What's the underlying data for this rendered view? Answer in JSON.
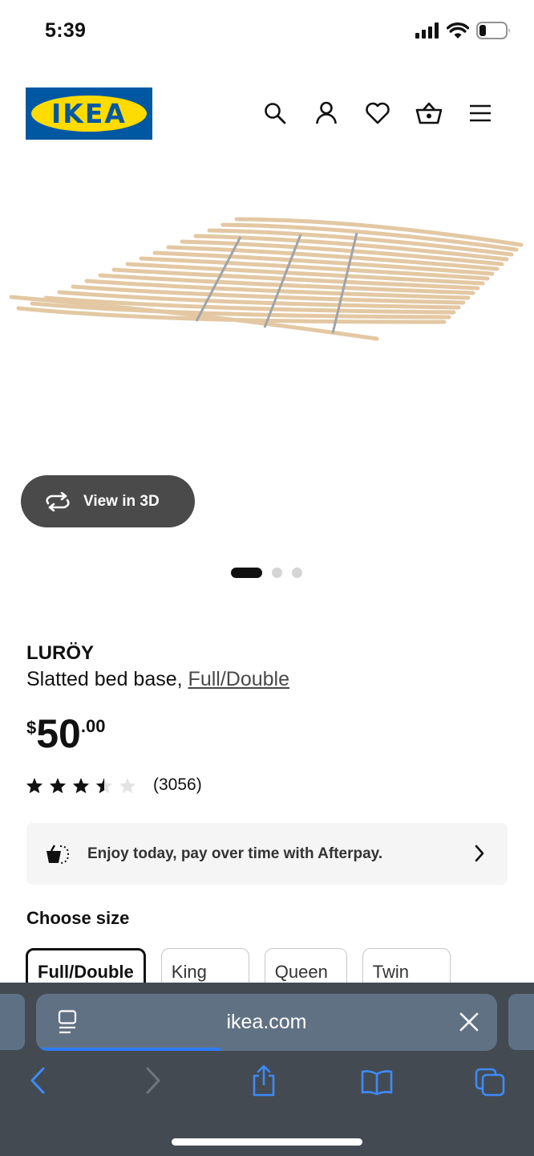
{
  "status_bar": {
    "time": "5:39"
  },
  "header": {
    "logo_text": "IKEA",
    "logo_reg": "®",
    "icons": [
      "search-icon",
      "account-icon",
      "heart-icon",
      "cart-icon",
      "menu-icon"
    ]
  },
  "gallery": {
    "view3d_label": "View in 3D",
    "active_index": 1,
    "count": 3
  },
  "product": {
    "name": "LURÖY",
    "description_prefix": "Slatted bed base, ",
    "description_link": "Full/Double",
    "price_currency": "$",
    "price_integer": "50",
    "price_decimal": ".00",
    "rating_stars": 3.5,
    "rating_max": 5,
    "review_count": "(3056)"
  },
  "afterpay": {
    "text": "Enjoy today, pay over time with Afterpay."
  },
  "size_selector": {
    "heading": "Choose size",
    "options": [
      "Full/Double",
      "King",
      "Queen",
      "Twin"
    ],
    "selected": "Full/Double"
  },
  "browser": {
    "url": "ikea.com",
    "load_progress": 0.4,
    "colors": {
      "accent": "#2e7cf6",
      "toolbar": "#444a52",
      "urlbar": "#617184"
    }
  },
  "colors": {
    "ikea_blue": "#0058a3",
    "ikea_yellow": "#ffdb00"
  }
}
